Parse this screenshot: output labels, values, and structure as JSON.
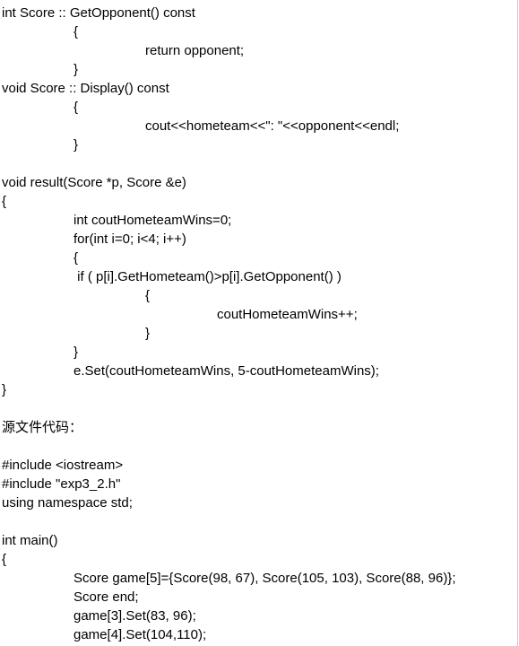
{
  "lines": [
    {
      "text": "int Score :: GetOpponent() const"
    },
    {
      "text": "{"
    },
    {
      "text": "return opponent;"
    },
    {
      "text": "}"
    },
    {
      "text": "void Score :: Display() const"
    },
    {
      "text": "{"
    },
    {
      "text": "cout<<hometeam<<\": \"<<opponent<<endl;"
    },
    {
      "text": "}"
    },
    {
      "text": ""
    },
    {
      "text": "void result(Score *p, Score &e)"
    },
    {
      "text": "{"
    },
    {
      "text": "int coutHometeamWins=0;"
    },
    {
      "text": "for(int i=0; i<4; i++)"
    },
    {
      "text": "{"
    },
    {
      "text": " if ( p[i].GetHometeam()>p[i].GetOpponent() )"
    },
    {
      "text": "{"
    },
    {
      "text": "coutHometeamWins++;"
    },
    {
      "text": "}"
    },
    {
      "text": "}"
    },
    {
      "text": "e.Set(coutHometeamWins, 5-coutHometeamWins);"
    },
    {
      "text": "}"
    },
    {
      "text": ""
    },
    {
      "text": "源文件代码："
    },
    {
      "text": ""
    },
    {
      "text": "#include <iostream>"
    },
    {
      "text": "#include \"exp3_2.h\""
    },
    {
      "text": "using namespace std;"
    },
    {
      "text": ""
    },
    {
      "text": "int main()"
    },
    {
      "text": "{"
    },
    {
      "text": "Score game[5]={Score(98, 67), Score(105, 103), Score(88, 96)};"
    },
    {
      "text": "Score end;"
    },
    {
      "text": "game[3].Set(83, 96);"
    },
    {
      "text": "game[4].Set(104,110);"
    }
  ]
}
